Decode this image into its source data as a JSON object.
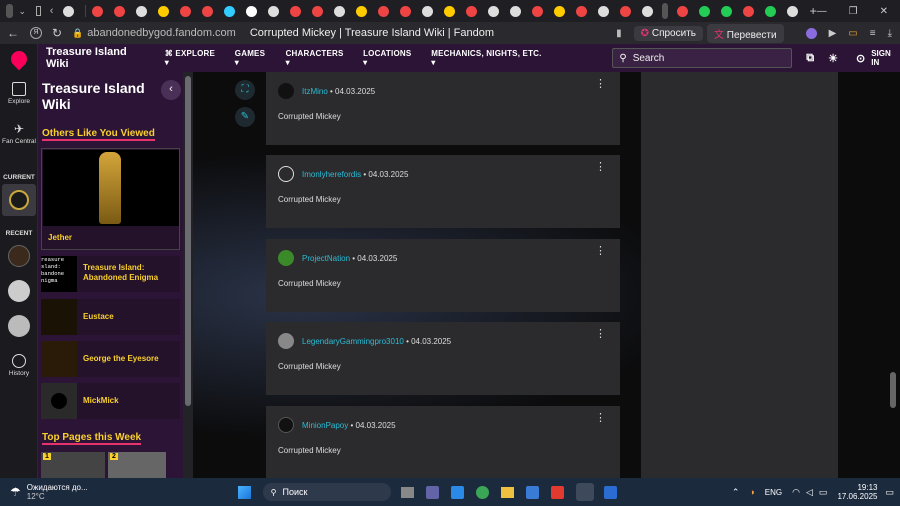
{
  "browser": {
    "address": "abandonedbygod.fandom.com",
    "page_title": "Corrupted Mickey | Treasure Island Wiki | Fandom",
    "ask_label": "Спросить",
    "translate_label": "Перевести"
  },
  "globalnav": {
    "explore": "Explore",
    "fan_central": "Fan Central",
    "current": "CURRENT",
    "recent": "RECENT",
    "history": "History"
  },
  "topnav": {
    "wiki_title": "Treasure Island Wiki",
    "menus": [
      "EXPLORE",
      "GAMES",
      "CHARACTERS",
      "LOCATIONS",
      "MECHANICS, NIGHTS, ETC."
    ],
    "search_placeholder": "Search",
    "sign_in": "SIGN IN"
  },
  "sidebar": {
    "heading": "Others Like You Viewed",
    "featured": "Jether",
    "items": [
      "Treasure Island: Abandoned Enigma",
      "Eustace",
      "George the Eyesore",
      "MickMick"
    ],
    "enigma_thumb_text": "reasure sland: bandone nigma",
    "top_pages_heading": "Top Pages this Week",
    "top_ranks": [
      "1",
      "2"
    ]
  },
  "comments": [
    {
      "author": "ItzMino",
      "date": "04.03.2025",
      "text": "Corrupted Mickey"
    },
    {
      "author": "Imonlyherefordis",
      "date": "04.03.2025",
      "text": "Corrupted Mickey"
    },
    {
      "author": "ProjectNation",
      "date": "04.03.2025",
      "text": "Corrupted Mickey"
    },
    {
      "author": "LegendaryGammingpro3010",
      "date": "04.03.2025",
      "text": "Corrupted Mickey"
    },
    {
      "author": "MinionPapoy",
      "date": "04.03.2025",
      "text": "Corrupted Mickey"
    }
  ],
  "taskbar": {
    "weather_text": "Ожидаются до...",
    "temperature": "12°C",
    "search_label": "Поиск",
    "lang": "ENG",
    "time": "19:13",
    "date": "17.06.2025"
  },
  "colors": {
    "accent": "#fad02c",
    "link": "#2bbcd6",
    "sidebar_bg": "#2b1435",
    "underline": "#e6336b"
  }
}
